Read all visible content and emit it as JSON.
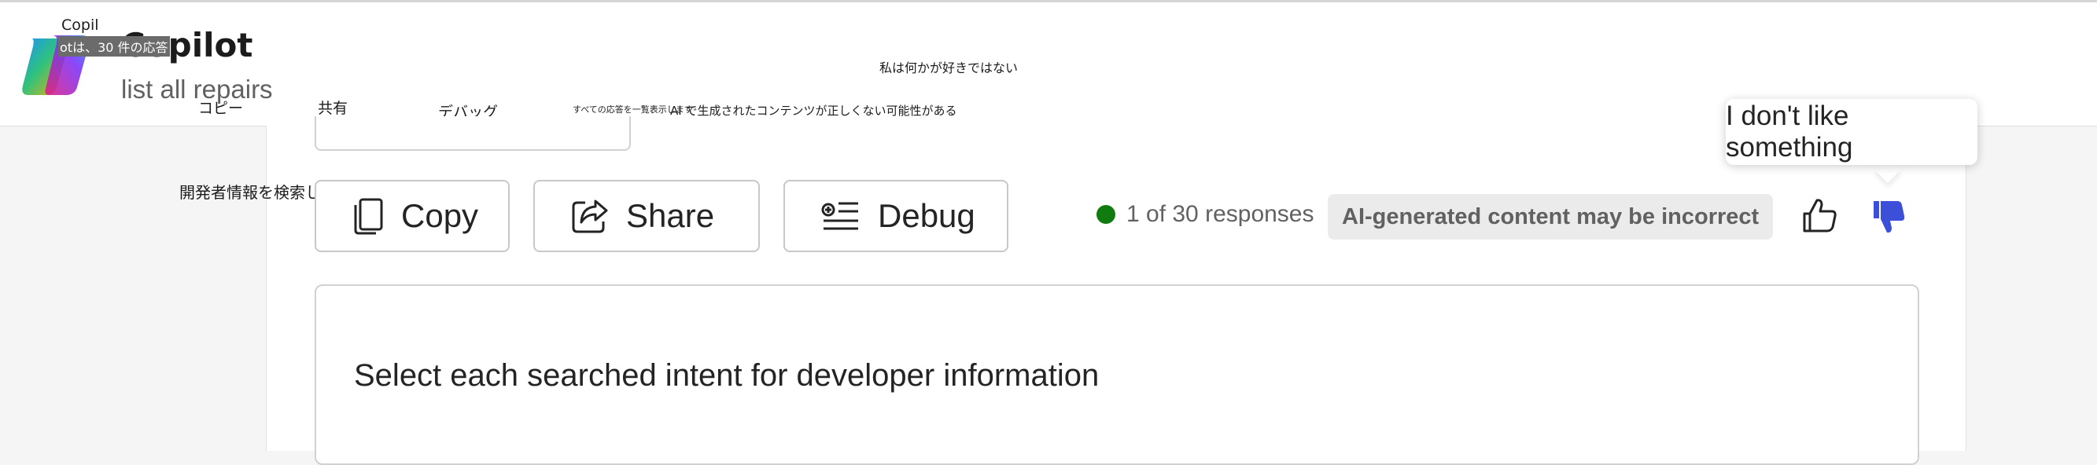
{
  "header": {
    "app_title": "Copilot",
    "subtitle": "list all repairs",
    "overlay_title": "Copil",
    "overlay_status_ja": "otは、30 件の応答",
    "ja_dislike": "私は何かが好きではない",
    "ja_copy": "コピー",
    "ja_share": "共有",
    "ja_debug": "デバッグ",
    "ja_show_all": "すべての応答を一覧表示します",
    "ja_ai_disclaimer": "AI で生成されたコンテンツが正しくない可能性がある",
    "ja_select_intent": "開発者情報を検索した各意図を選択する"
  },
  "toolbar": {
    "copy_label": "Copy",
    "share_label": "Share",
    "debug_label": "Debug",
    "status_text": "1 of 30 responses",
    "disclaimer": "AI-generated content may be incorrect"
  },
  "tooltip": {
    "text": "I don't like something"
  },
  "message": {
    "text": "Select each searched intent for developer information"
  },
  "colors": {
    "status_dot": "#107c10",
    "dislike_active": "#3b4fd8",
    "logo_gradient": [
      "#1e90ff",
      "#2ec27e",
      "#ffb000",
      "#e01b84",
      "#7b2ff7"
    ]
  },
  "icons": [
    "copilot-logo",
    "copy-icon",
    "share-icon",
    "debug-icon",
    "thumbs-up-icon",
    "thumbs-down-icon"
  ]
}
